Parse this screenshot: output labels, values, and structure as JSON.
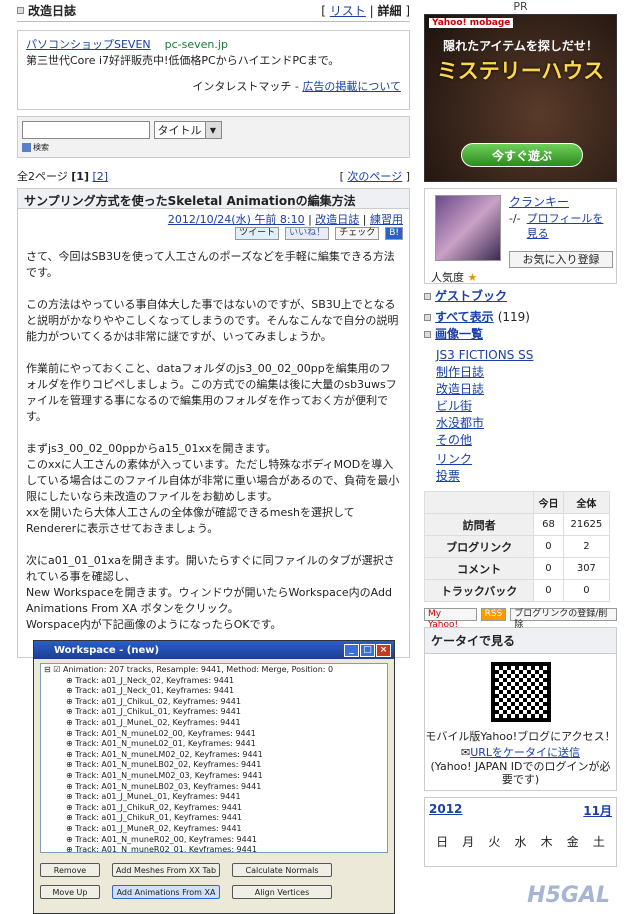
{
  "pr_label": "PR",
  "header": {
    "title": "改造日誌",
    "list_link": "リスト",
    "detail_link": "詳細"
  },
  "ad": {
    "link": "パソコンショップSEVEN",
    "url": "pc-seven.jp",
    "text": "第三世代Core i7好評販売中!低価格PCからハイエンドPCまで。",
    "provider": "インタレストマッチ",
    "provider_link": "広告の掲載について"
  },
  "search": {
    "select_value": "タイトル",
    "button": "検索"
  },
  "paging": {
    "text": "全2ページ",
    "current": "[1]",
    "page2": "[2]",
    "next": "次のページ"
  },
  "post": {
    "title": "サンプリング方式を使ったSkeletal Animationの編集方法",
    "date": "2012/10/24(水) 午前 8:10",
    "cat1": "改造日誌",
    "cat2": "練習用",
    "share": {
      "tweet": "ツイート",
      "like": "いいね！",
      "check": "チェック",
      "b": "B!"
    },
    "paragraphs": [
      "さて、今回はSB3Uを使って人工さんのポーズなどを手軽に編集できる方法です。",
      "この方法はやっている事自体大した事ではないのですが、SB3U上でとなると説明がかなりややこしくなってしまうのです。そんなこんなで自分の説明能力がついてくるかは非常に謎ですが、いってみましょうか。",
      "作業前にやっておくこと、dataフォルダのjs3_00_02_00ppを編集用のフォルダを作りコピペしましょう。この方式での編集は後に大量のsb3uwsファイルを管理する事になるので編集用のフォルダを作っておく方が便利です。",
      "まずjs3_00_02_00ppからa15_01xxを開きます。\nこのxxに人工さんの素体が入っています。ただし特殊なボディMODを導入している場合はこのファイル自体が非常に重い場合があるので、負荷を最小限にしたいなら未改造のファイルをお勧めします。\nxxを開いたら大体人工さんの全体像が確認できるmeshを選択してRendererに表示させておきましょう。",
      "次にa01_01_01xaを開きます。開いたらすぐに同ファイルのタブが選択されている事を確認し、\nNew Workspaceを開きます。ウィンドウが開いたらWorkspace内のAdd Animations From XA ボタンをクリック。\nWorspace内が下記画像のようになったらOKです。"
    ]
  },
  "workspace": {
    "title": "Workspace - (new)",
    "root": "Animation: 207 tracks, Resample: 9441, Method: Merge, Position: 0",
    "tracks": [
      "Track: a01_J_Neck_02, Keyframes: 9441",
      "Track: a01_J_Neck_01, Keyframes: 9441",
      "Track: a01_J_ChikuL_02, Keyframes: 9441",
      "Track: a01_J_ChikuL_01, Keyframes: 9441",
      "Track: a01_J_MuneL_02, Keyframes: 9441",
      "Track: A01_N_muneL02_00, Keyframes: 9441",
      "Track: A01_N_muneL02_01, Keyframes: 9441",
      "Track: A01_N_muneLM02_02, Keyframes: 9441",
      "Track: A01_N_muneLB02_02, Keyframes: 9441",
      "Track: A01_N_muneLM02_03, Keyframes: 9441",
      "Track: A01_N_muneLB02_03, Keyframes: 9441",
      "Track: a01_J_MuneL_01, Keyframes: 9441",
      "Track: a01_J_ChikuR_02, Keyframes: 9441",
      "Track: a01_J_ChikuR_01, Keyframes: 9441",
      "Track: a01_J_MuneR_02, Keyframes: 9441",
      "Track: A01_N_muneR02_00, Keyframes: 9441",
      "Track: A01_N_muneR02_01, Keyframes: 9441",
      "Track: A01_N_muneRM02_02, Keyframes: 9441"
    ],
    "buttons": {
      "remove": "Remove",
      "move_up": "Move Up",
      "add_meshes": "Add Meshes From XX Tab",
      "add_anims": "Add Animations From XA",
      "calc_normals": "Calculate Normals",
      "align_vertices": "Align Vertices"
    }
  },
  "banner": {
    "brand": "Yahoo! mobage",
    "headline": "隠れたアイテムを探しだせ！",
    "title": "ミステリーハウス",
    "cta": "今すぐ遊ぶ"
  },
  "profile": {
    "name": "クランキー",
    "sub": "-/-",
    "profile_link": "プロフィールを見る",
    "fav_button": "お気に入り登録",
    "popularity": "人気度"
  },
  "sidebar_links": {
    "guestbook": "ゲストブック",
    "show_all": "すべて表示",
    "show_all_count": "(119)",
    "images": "画像一覧",
    "cats": [
      "JS3 FICTIONS SS",
      "制作日誌",
      "改造日誌",
      "ビル街",
      "水没都市",
      "その他"
    ],
    "link": "リンク",
    "vote": "投票"
  },
  "stats": {
    "today": "今日",
    "total": "全体",
    "rows": [
      {
        "label": "訪問者",
        "today": "68",
        "total": "21625"
      },
      {
        "label": "ブログリンク",
        "today": "0",
        "total": "2"
      },
      {
        "label": "コメント",
        "today": "0",
        "total": "307"
      },
      {
        "label": "トラックバック",
        "today": "0",
        "total": "0"
      }
    ]
  },
  "feeds": {
    "yahoo": "My Yahoo!",
    "rss": "RSS",
    "bloglink": "ブログリンクの登録/削除"
  },
  "mobile": {
    "title": "ケータイで見る",
    "text": "モバイル版Yahoo!ブログにアクセス！",
    "send_link": "URLをケータイに送信",
    "note": "(Yahoo! JAPAN IDでのログインが必要です)"
  },
  "calendar": {
    "year": "2012",
    "month": "11月",
    "days": [
      "日",
      "月",
      "火",
      "水",
      "木",
      "金",
      "土"
    ]
  },
  "watermark": "H5GAL"
}
